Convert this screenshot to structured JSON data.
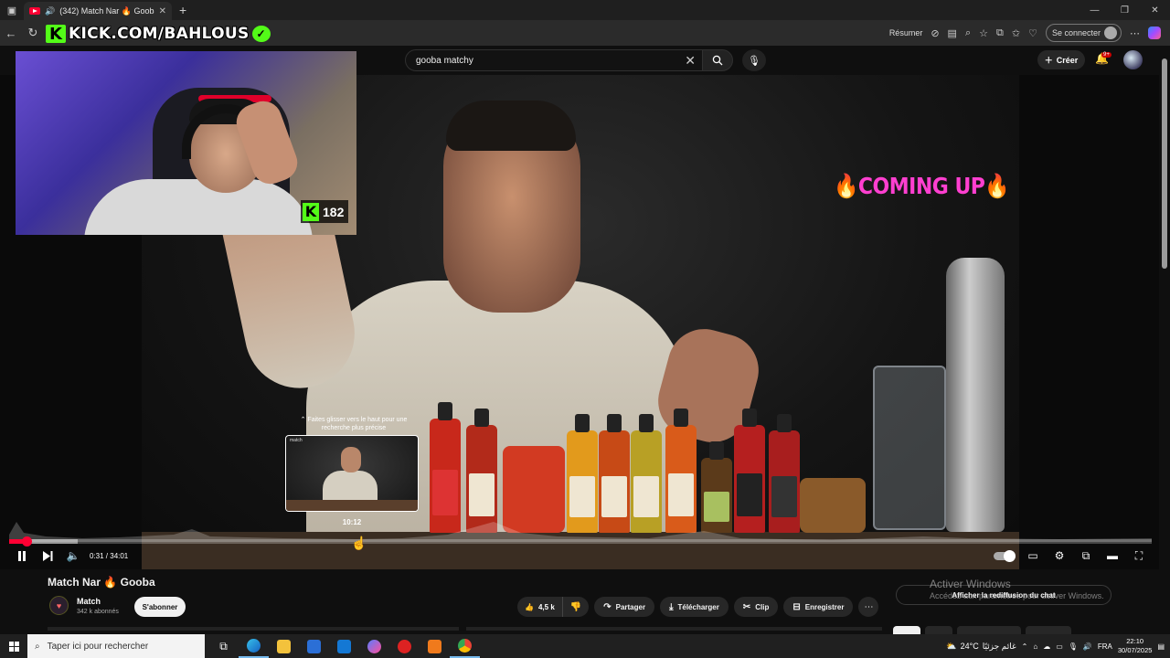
{
  "browser": {
    "tab_title": "(342) Match Nar 🔥 Gooba",
    "new_tab": "+",
    "summarize_label": "Résumer",
    "signin_label": "Se connecter"
  },
  "overlay": {
    "kick_url": "KICK.COM/BAHLOUS",
    "viewer_count": "182",
    "coming_up": "🔥COMING UP🔥"
  },
  "youtube": {
    "search_value": "gooba matchy",
    "create_label": "Créer",
    "notif_count": "9+"
  },
  "player": {
    "seek_hint_line1": "⌃ Faites glisser vers le haut pour une",
    "seek_hint_line2": "recherche plus précise",
    "preview_channel": "match",
    "preview_time": "10:12",
    "current_time": "0:31",
    "duration": "34:01",
    "time_display": "0:31 / 34:01",
    "progress_played": 0.015,
    "progress_buffered": 0.06,
    "hover_position": 0.3
  },
  "video": {
    "title": "Match Nar 🔥 Gooba",
    "channel_name": "Match",
    "subscribers": "342 k abonnés",
    "subscribe_label": "S'abonner",
    "likes": "4,5 k",
    "share_label": "Partager",
    "download_label": "Télécharger",
    "clip_label": "Clip",
    "save_label": "Enregistrer"
  },
  "sidebar": {
    "chat_replay_label": "Afficher la rediffusion du chat"
  },
  "watermark": {
    "line1": "Activer Windows",
    "line2": "Accédez aux paramètres pour activer Windows."
  },
  "taskbar": {
    "search_placeholder": "Taper ici pour rechercher",
    "weather_temp": "24°C",
    "weather_text": "غائم جزئيًا",
    "language": "FRA",
    "time": "22:10",
    "date": "30/07/2025"
  },
  "colors": {
    "kick_green": "#53fc18",
    "youtube_red": "#ff0033",
    "coming_up_pink": "#ff3fd0"
  }
}
